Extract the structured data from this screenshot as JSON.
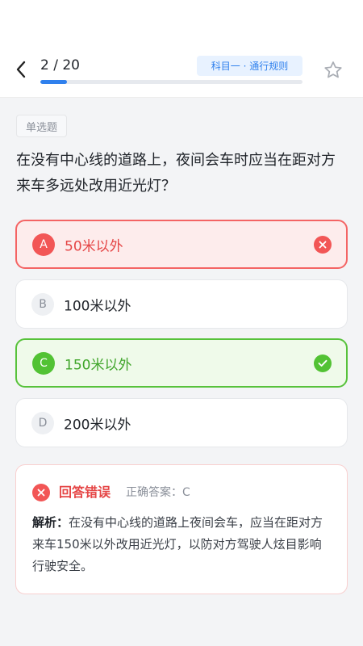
{
  "header": {
    "progress_text": "2 / 20",
    "progress_current": 2,
    "progress_total": 20,
    "subject_tag": "科目一 · 通行规则",
    "icons": {
      "back": "chevron-left-icon",
      "favorite": "star-outline-icon"
    }
  },
  "question": {
    "type_label": "单选题",
    "text": "在没有中心线的道路上，夜间会车时应当在距对方来车多远处改用近光灯？"
  },
  "options": [
    {
      "letter": "A",
      "text": "50米以外",
      "state": "wrong"
    },
    {
      "letter": "B",
      "text": "100米以外",
      "state": "normal"
    },
    {
      "letter": "C",
      "text": "150米以外",
      "state": "correct"
    },
    {
      "letter": "D",
      "text": "200米以外",
      "state": "normal"
    }
  ],
  "result": {
    "title": "回答错误",
    "correct_answer_text": "正确答案：C",
    "analysis_label": "解析：",
    "analysis_text": "在没有中心线的道路上夜间会车，应当在距对方来车150米以外改用近光灯，以防对方驾驶人炫目影响行驶安全。"
  },
  "colors": {
    "accent": "#2f80ed",
    "wrong": "#f25656",
    "correct": "#52c234"
  }
}
